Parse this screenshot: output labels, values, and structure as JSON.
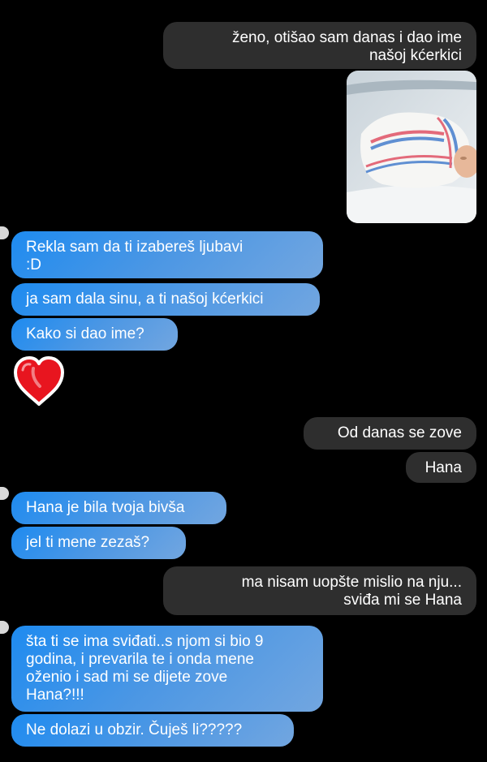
{
  "conversation": {
    "messages": [
      {
        "side": "out",
        "text": "ženo, otišao sam danas i dao ime\nnašoj kćerkici"
      },
      {
        "side": "in",
        "text": "Rekla sam da ti izabereš ljubavi\n:D"
      },
      {
        "side": "in",
        "text": "ja sam dala sinu, a ti našoj kćerkici"
      },
      {
        "side": "in",
        "text": "Kako si dao ime?"
      },
      {
        "side": "out",
        "text": "Od danas se zove"
      },
      {
        "side": "out",
        "text": "Hana"
      },
      {
        "side": "in",
        "text": "Hana je bila tvoja bivša"
      },
      {
        "side": "in",
        "text": "jel ti mene zezaš?"
      },
      {
        "side": "out",
        "text": "ma nisam uopšte mislio na nju...\nsviđa mi se Hana"
      },
      {
        "side": "in",
        "text": "šta ti se ima sviđati..s njom si bio 9\ngodina, i prevarila te i onda mene\noženio i sad mi se dijete zove\nHana?!!!"
      },
      {
        "side": "in",
        "text": "Ne dolazi u obzir. Čuješ li?????"
      }
    ],
    "attachments": {
      "photo_icon": "newborn-baby-photo",
      "emoji_icon": "red-heart-icon"
    }
  },
  "colors": {
    "background": "#000000",
    "outgoing_bubble": "#2e2e2e",
    "incoming_gradient_start": "#1e8bf0",
    "incoming_gradient_end": "#72a6e0",
    "heart": "#e8151f"
  }
}
